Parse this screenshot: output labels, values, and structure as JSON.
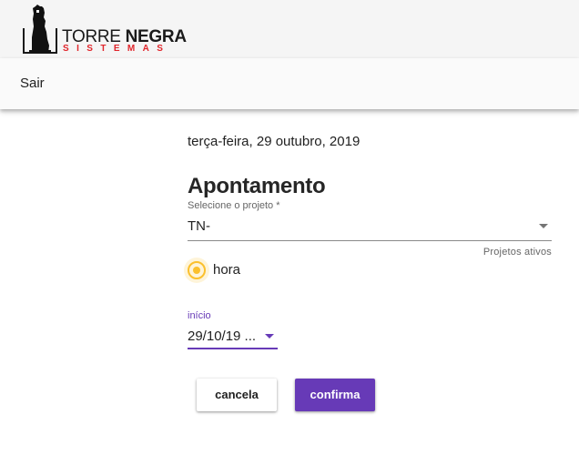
{
  "header": {
    "logo": {
      "word_light": "TORRE ",
      "word_bold": "NEGRA",
      "subtitle": "SISTEMAS"
    }
  },
  "menu": {
    "sair_label": "Sair"
  },
  "main": {
    "date": "terça-feira, 29 outubro, 2019",
    "title": "Apontamento",
    "project_select": {
      "label": "Selecione o projeto *",
      "value": "TN-",
      "hint": "Projetos ativos"
    },
    "radio": {
      "label": "hora",
      "checked": true
    },
    "inicio": {
      "label": "início",
      "value": "29/10/19 ..."
    },
    "buttons": {
      "cancel_label": "cancela",
      "confirm_label": "confirma"
    }
  },
  "colors": {
    "accent": "#673ab7",
    "radio": "#fbc02d",
    "brand_red": "#e0262c"
  }
}
